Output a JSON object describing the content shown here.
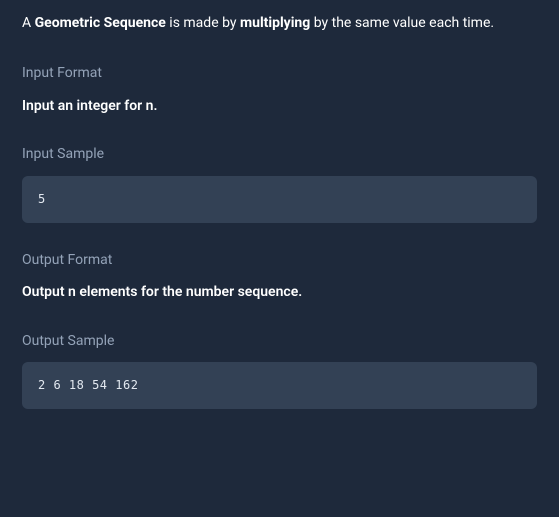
{
  "intro": {
    "prefix": "A ",
    "term1": "Geometric Sequence",
    "mid": " is made by ",
    "term2": "multiplying",
    "suffix": " by the same value each time."
  },
  "input_format": {
    "label": "Input Format",
    "text": "Input an integer for n."
  },
  "input_sample": {
    "label": "Input Sample",
    "code": "5"
  },
  "output_format": {
    "label": "Output Format",
    "text": "Output n elements for the number sequence."
  },
  "output_sample": {
    "label": "Output Sample",
    "code": "2 6 18 54 162"
  }
}
